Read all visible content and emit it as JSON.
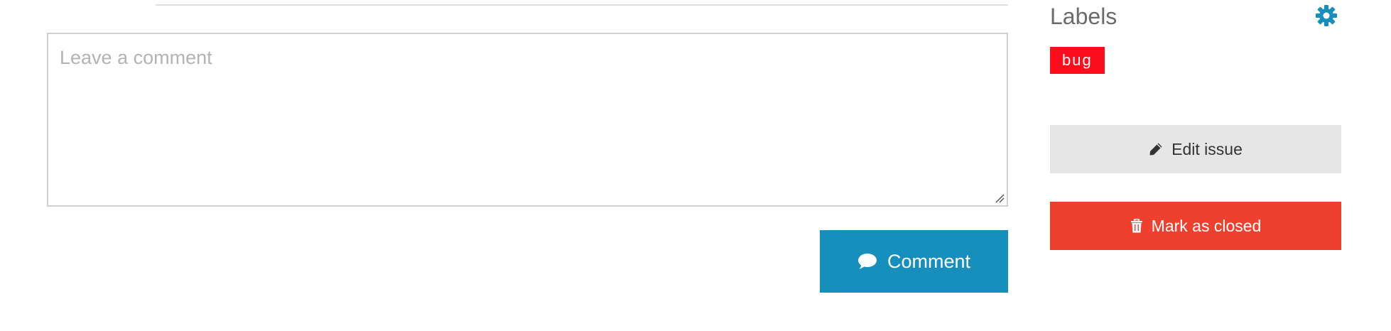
{
  "comment_form": {
    "placeholder": "Leave a comment",
    "submit_label": "Comment",
    "submit_icon": "comment-bubble-icon",
    "submit_color": "#168fbc"
  },
  "sidebar": {
    "labels_title": "Labels",
    "settings_icon": "gear-icon",
    "accent_color": "#168fbc",
    "labels": [
      {
        "name": "bug",
        "color": "#fc0d1b"
      }
    ],
    "edit_button": {
      "label": "Edit issue",
      "icon": "pencil-icon"
    },
    "close_button": {
      "label": "Mark as closed",
      "icon": "trash-icon",
      "color": "#ee402e"
    }
  }
}
